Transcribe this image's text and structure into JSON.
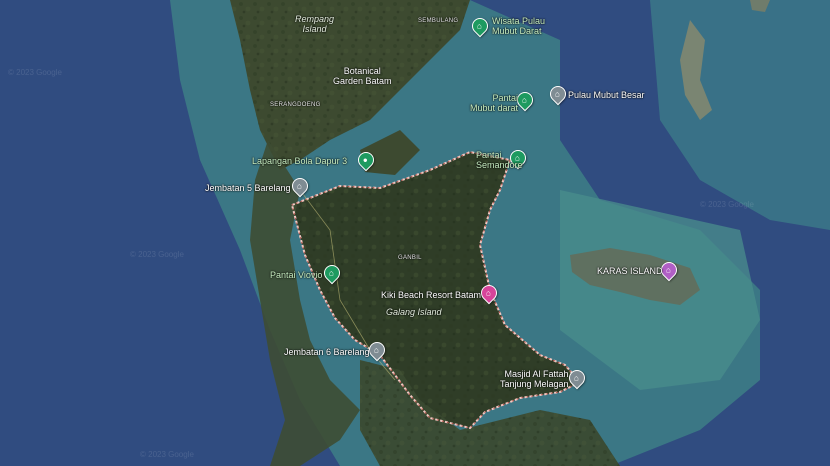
{
  "map": {
    "places": [
      {
        "id": "wisata-pulau-mubut-darat",
        "label": "Wisata Pulau\nMubut Darat",
        "icon": "park-icon",
        "pin_color": "#1e9a60"
      },
      {
        "id": "pantai-mubut-darat",
        "label": "Pantai\nMubut darat",
        "icon": "beach-icon",
        "pin_color": "#1e9a60"
      },
      {
        "id": "pulau-mubut-besar",
        "label": "Pulau Mubut Besar",
        "icon": "landmark-icon",
        "pin_color": "#7f8c93"
      },
      {
        "id": "lapangan-bola",
        "label": "Lapangan Bola Dapur 3",
        "icon": "sports-icon",
        "pin_color": "#1e9a60"
      },
      {
        "id": "pantai-semandore",
        "label": "Pantai\nSemandore",
        "icon": "beach-icon",
        "pin_color": "#1e9a60"
      },
      {
        "id": "jembatan-5",
        "label": "Jembatan 5 Barelang",
        "icon": "bridge-icon",
        "pin_color": "#7f8c93"
      },
      {
        "id": "pantai-viovio",
        "label": "Pantai Viovio",
        "icon": "beach-icon",
        "pin_color": "#1e9a60"
      },
      {
        "id": "kiki-beach",
        "label": "Kiki Beach Resort Batam",
        "icon": "hotel-icon",
        "pin_color": "#d6449a"
      },
      {
        "id": "karas-island",
        "label": "KARAS ISLAND",
        "icon": "hotel-icon",
        "pin_color": "#b05fc5"
      },
      {
        "id": "jembatan-6",
        "label": "Jembatan 6 Barelang",
        "icon": "bridge-icon",
        "pin_color": "#7f8c93"
      },
      {
        "id": "masjid-al-fattah",
        "label": "Masjid Al Fattah\nTanjung Melagan",
        "icon": "mosque-icon",
        "pin_color": "#7f8c93"
      }
    ],
    "area_labels": {
      "rempang": "Rempang\nIsland",
      "sembulang": "SEMBULANG",
      "botanical": "Botanical\nGarden Batam",
      "sembuloeng": "SERANGDOENG",
      "ganbil": "GANBIL",
      "galang": "Galang Island"
    },
    "watermark": "© 2023 Google"
  }
}
